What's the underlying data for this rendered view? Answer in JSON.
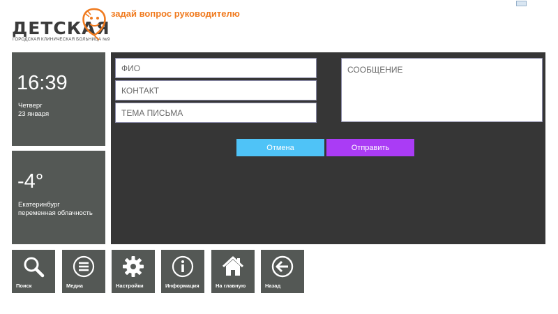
{
  "header": {
    "logo_text": "ДЕТСКАЯ",
    "logo_subtitle": "Городская клиническая больница №9",
    "title": "задай вопрос руководителю"
  },
  "clock": {
    "time": "16:39",
    "weekday": "Четверг",
    "date": "23 января"
  },
  "weather": {
    "temperature": "-4°",
    "city": "Екатеринбург",
    "condition": "переменная облачность"
  },
  "form": {
    "name_placeholder": "ФИО",
    "contact_placeholder": "КОНТАКТ",
    "subject_placeholder": "ТЕМА ПИСЬМА",
    "message_placeholder": "СООБЩЕНИЕ",
    "cancel_label": "Отмена",
    "send_label": "Отправить"
  },
  "nav": [
    {
      "label": "Поиск",
      "icon": "search-icon"
    },
    {
      "label": "Медиа",
      "icon": "menu-icon"
    },
    {
      "label": "Настройки",
      "icon": "gear-icon"
    },
    {
      "label": "Информация",
      "icon": "info-icon"
    },
    {
      "label": "На главную",
      "icon": "home-icon"
    },
    {
      "label": "Назад",
      "icon": "back-arrow-icon"
    }
  ],
  "colors": {
    "accent_orange": "#f07a1e",
    "tile_gray": "#545855",
    "panel_dark": "#363636",
    "cancel_blue": "#4fc3f7",
    "send_purple": "#aa3cf5"
  }
}
